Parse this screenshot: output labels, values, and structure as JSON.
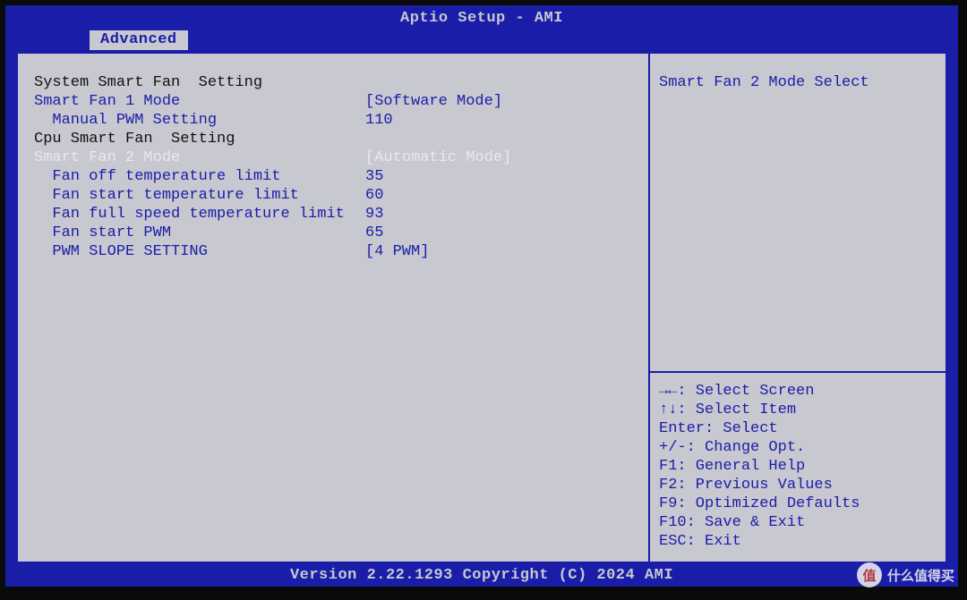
{
  "header": {
    "title": "Aptio Setup - AMI"
  },
  "tab": {
    "label": "Advanced"
  },
  "settings": {
    "section1_header": "System Smart Fan  Setting",
    "smart_fan1_mode": {
      "label": "Smart Fan 1 Mode",
      "value": "[Software Mode]"
    },
    "manual_pwm": {
      "label": "  Manual PWM Setting",
      "value": "110"
    },
    "section2_header": "Cpu Smart Fan  Setting",
    "smart_fan2_mode": {
      "label": "Smart Fan 2 Mode",
      "value": "[Automatic Mode]"
    },
    "fan_off_temp": {
      "label": "  Fan off temperature limit",
      "value": "35"
    },
    "fan_start_temp": {
      "label": "  Fan start temperature limit",
      "value": "60"
    },
    "fan_full_temp": {
      "label": "  Fan full speed temperature limit",
      "value": "93"
    },
    "fan_start_pwm": {
      "label": "  Fan start PWM",
      "value": "65"
    },
    "pwm_slope": {
      "label": "  PWM SLOPE SETTING",
      "value": "[4 PWM]"
    }
  },
  "help": {
    "title": "Smart Fan 2 Mode Select",
    "keys": [
      "→←: Select Screen",
      "↑↓: Select Item",
      "Enter: Select",
      "+/-: Change Opt.",
      "F1: General Help",
      "F2: Previous Values",
      "F9: Optimized Defaults",
      "F10: Save & Exit",
      "ESC: Exit"
    ]
  },
  "footer": {
    "text": "Version 2.22.1293 Copyright (C) 2024 AMI"
  },
  "watermark": {
    "badge": "值",
    "text": "什么值得买"
  }
}
